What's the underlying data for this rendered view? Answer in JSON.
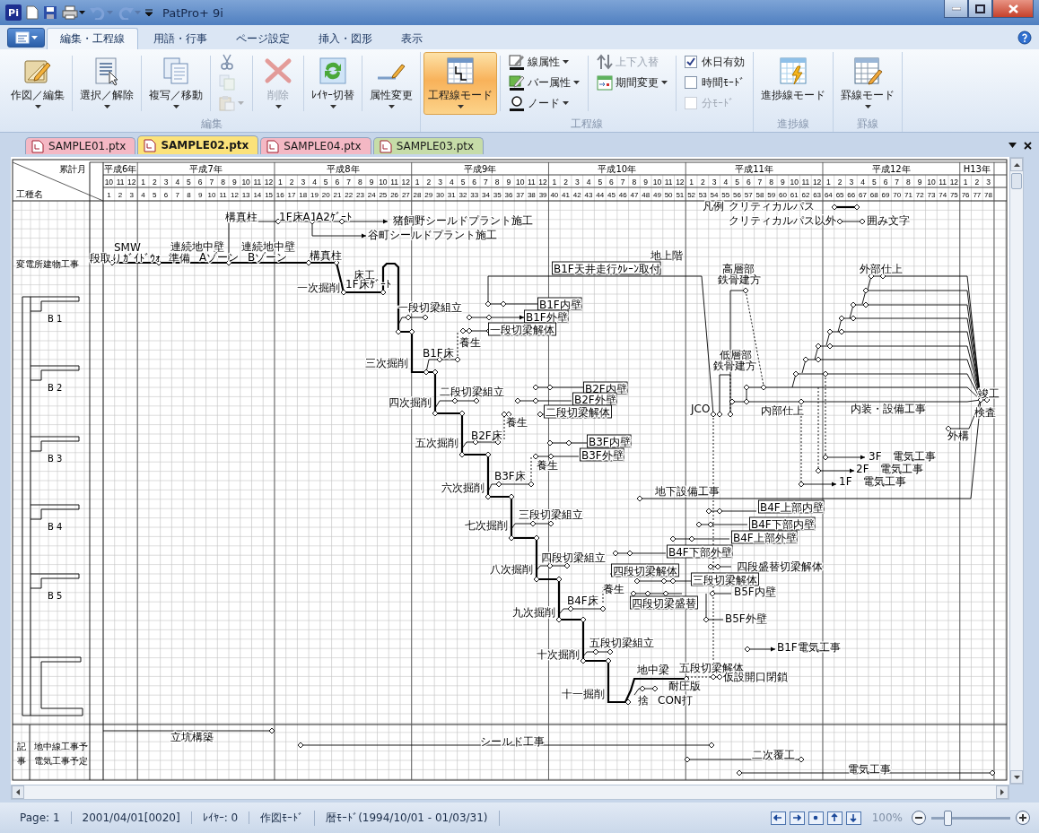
{
  "window": {
    "logo": "Pi",
    "title": "PatPro+ 9i"
  },
  "ribbon": {
    "tabs": [
      {
        "label": "編集・工程線",
        "selected": true
      },
      {
        "label": "用語・行事",
        "selected": false
      },
      {
        "label": "ページ設定",
        "selected": false
      },
      {
        "label": "挿入・図形",
        "selected": false
      },
      {
        "label": "表示",
        "selected": false
      }
    ],
    "groups": [
      {
        "label": "編集",
        "items": [
          {
            "kind": "large",
            "label": "作図／編集",
            "dropdown": true,
            "disabled": false,
            "on": false
          },
          {
            "kind": "large",
            "label": "選択／解除",
            "dropdown": true,
            "disabled": false,
            "on": false
          },
          {
            "kind": "large",
            "label": "複写／移動",
            "dropdown": true,
            "disabled": false,
            "on": false
          },
          {
            "kind": "stack",
            "items": [
              {
                "kind": "icon",
                "dropdown": false,
                "disabled": false
              },
              {
                "kind": "icon",
                "dropdown": false,
                "disabled": true
              },
              {
                "kind": "icon",
                "dropdown": true,
                "disabled": true
              }
            ]
          },
          {
            "kind": "large",
            "label": "削除",
            "dropdown": true,
            "disabled": true,
            "on": false
          },
          {
            "kind": "large",
            "label": "ﾚｲﾔｰ切替",
            "dropdown": true,
            "disabled": false,
            "on": false
          },
          {
            "kind": "large",
            "label": "属性変更",
            "dropdown": true,
            "disabled": false,
            "on": false
          }
        ]
      },
      {
        "label": "工程線",
        "items": [
          {
            "kind": "large",
            "label": "工程線モード",
            "dropdown": true,
            "disabled": false,
            "on": true
          },
          {
            "kind": "stack",
            "items": [
              {
                "kind": "tool",
                "label": "線属性",
                "dropdown": true,
                "disabled": false
              },
              {
                "kind": "tool",
                "label": "バー属性",
                "dropdown": true,
                "disabled": false
              },
              {
                "kind": "tool",
                "label": "ノード",
                "dropdown": true,
                "disabled": false
              }
            ]
          },
          {
            "kind": "stack",
            "items": [
              {
                "kind": "tool",
                "label": "上下入替",
                "dropdown": false,
                "disabled": true
              },
              {
                "kind": "tool",
                "label": "期間変更",
                "dropdown": true,
                "disabled": false
              }
            ]
          },
          {
            "kind": "stack",
            "items": [
              {
                "kind": "check",
                "label": "休日有効",
                "checked": true,
                "disabled": false
              },
              {
                "kind": "check",
                "label": "時間ﾓｰﾄﾞ",
                "checked": false,
                "disabled": false
              },
              {
                "kind": "check",
                "label": "分ﾓｰﾄﾞ",
                "checked": false,
                "disabled": true
              }
            ]
          }
        ]
      },
      {
        "label": "進捗線",
        "items": [
          {
            "kind": "large",
            "label": "進捗線モード",
            "dropdown": false,
            "disabled": false,
            "on": false
          }
        ]
      },
      {
        "label": "罫線",
        "items": [
          {
            "kind": "large",
            "label": "罫線モード",
            "dropdown": true,
            "disabled": false,
            "on": false
          }
        ]
      }
    ]
  },
  "documents": [
    {
      "label": "SAMPLE01.ptx",
      "selected": false,
      "color": "#f4b8c4"
    },
    {
      "label": "SAMPLE02.ptx",
      "selected": true,
      "color": "#fbe27a"
    },
    {
      "label": "SAMPLE04.ptx",
      "selected": false,
      "color": "#f4b8c4"
    },
    {
      "label": "SAMPLE03.ptx",
      "selected": false,
      "color": "#c6dca8"
    }
  ],
  "timeline": {
    "corner_top": "累計月",
    "corner_bottom": "工種名",
    "years": [
      "平成6年",
      "平成7年",
      "平成8年",
      "平成9年",
      "平成10年",
      "平成11年",
      "平成12年",
      "H13年"
    ],
    "months": [
      "10",
      "11",
      "12",
      "1",
      "2",
      "3",
      "4",
      "5",
      "6",
      "7",
      "8",
      "9",
      "10",
      "11",
      "12",
      "1",
      "2",
      "3",
      "4",
      "5",
      "6",
      "7",
      "8",
      "9",
      "10",
      "11",
      "12",
      "1",
      "2",
      "3",
      "4",
      "5",
      "6",
      "7",
      "8",
      "9",
      "10",
      "11",
      "12",
      "1",
      "2",
      "3",
      "4",
      "5",
      "6",
      "7",
      "8",
      "9",
      "10",
      "11",
      "12",
      "1",
      "2",
      "3",
      "4",
      "5",
      "6",
      "7",
      "8",
      "9",
      "10",
      "11",
      "12",
      "1",
      "2",
      "3",
      "4",
      "5",
      "6",
      "7",
      "8",
      "9",
      "10",
      "11",
      "12",
      "1",
      "2",
      "3"
    ],
    "numbers": [
      "1",
      "2",
      "3",
      "4",
      "5",
      "6",
      "7",
      "8",
      "9",
      "10",
      "11",
      "12",
      "13",
      "14",
      "15",
      "16",
      "17",
      "18",
      "19",
      "20",
      "21",
      "22",
      "23",
      "24",
      "25",
      "26",
      "27",
      "28",
      "29",
      "30",
      "31",
      "32",
      "33",
      "34",
      "35",
      "36",
      "37",
      "38",
      "39",
      "40",
      "41",
      "42",
      "43",
      "44",
      "45",
      "46",
      "47",
      "48",
      "49",
      "50",
      "51",
      "52",
      "53",
      "54",
      "55",
      "56",
      "57",
      "58",
      "59",
      "60",
      "61",
      "62",
      "63",
      "64",
      "65",
      "66",
      "67",
      "68",
      "69",
      "70",
      "71",
      "72",
      "73",
      "74",
      "75",
      "76",
      "77",
      "78"
    ]
  },
  "work_rows": {
    "main": "変電所建物工事",
    "levels": [
      "B 1",
      "B 2",
      "B 3",
      "B 4",
      "B 5"
    ],
    "notes_title": "記事",
    "notes": [
      "地中線工事予",
      "電気工事予定"
    ]
  },
  "diagram": {
    "labels": [
      {
        "text": "凡例",
        "boxed": false
      },
      {
        "text": "クリティカルパス",
        "boxed": false
      },
      {
        "text": "構真柱",
        "boxed": false
      },
      {
        "text": "1F床A1",
        "boxed": false
      },
      {
        "text": "A2ｹﾞｰﾄ",
        "boxed": false
      },
      {
        "text": "猪飼野シールドプラント施工",
        "boxed": false
      },
      {
        "text": "クリティカルパス以外",
        "boxed": false
      },
      {
        "text": "囲み文字",
        "boxed": false
      },
      {
        "text": "谷町シールドプラント施工",
        "boxed": false
      },
      {
        "text": "SMW",
        "boxed": false
      },
      {
        "text": "連続地中壁",
        "boxed": false
      },
      {
        "text": "連続地中壁",
        "boxed": false
      },
      {
        "text": "段取り",
        "boxed": false
      },
      {
        "text": "ｶﾞｲﾄﾞｳｫ",
        "boxed": false
      },
      {
        "text": "準備",
        "boxed": false
      },
      {
        "text": "Aゾーン",
        "boxed": false
      },
      {
        "text": "Bゾーン",
        "boxed": false
      },
      {
        "text": "構真柱",
        "boxed": false
      },
      {
        "text": "地上階",
        "boxed": false
      },
      {
        "text": "B1F天井走行ｸﾚｰﾝ取付",
        "boxed": true
      },
      {
        "text": "高層部",
        "boxed": false
      },
      {
        "text": "外部仕上",
        "boxed": false
      },
      {
        "text": "床工",
        "boxed": false
      },
      {
        "text": "鉄骨建方",
        "boxed": false
      },
      {
        "text": "一次掘削",
        "boxed": false
      },
      {
        "text": "1F床ｹﾞｰﾄ",
        "boxed": false
      },
      {
        "text": "一段切梁組立",
        "boxed": false
      },
      {
        "text": "B1F内壁",
        "boxed": true
      },
      {
        "text": "B1F外壁",
        "boxed": true
      },
      {
        "text": "一段切梁解体",
        "boxed": true
      },
      {
        "text": "養生",
        "boxed": false
      },
      {
        "text": "B1F床",
        "boxed": false
      },
      {
        "text": "低層部",
        "boxed": false
      },
      {
        "text": "三次掘削",
        "boxed": false
      },
      {
        "text": "鉄骨建方",
        "boxed": false
      },
      {
        "text": "二段切梁組立",
        "boxed": false
      },
      {
        "text": "B2F内壁",
        "boxed": true
      },
      {
        "text": "竣工",
        "boxed": false
      },
      {
        "text": "四次掘削",
        "boxed": false
      },
      {
        "text": "B2F外壁",
        "boxed": true
      },
      {
        "text": "二段切梁解体",
        "boxed": true
      },
      {
        "text": "JCO",
        "boxed": false
      },
      {
        "text": "内部仕上",
        "boxed": false
      },
      {
        "text": "内装・設備工事",
        "boxed": false
      },
      {
        "text": "検査",
        "boxed": false
      },
      {
        "text": "養生",
        "boxed": false
      },
      {
        "text": "B2F床",
        "boxed": false
      },
      {
        "text": "外構",
        "boxed": false
      },
      {
        "text": "五次掘削",
        "boxed": false
      },
      {
        "text": "B3F内壁",
        "boxed": true
      },
      {
        "text": "B3F外壁",
        "boxed": true
      },
      {
        "text": "3F　電気工事",
        "boxed": false
      },
      {
        "text": "養生",
        "boxed": false
      },
      {
        "text": "2F　電気工事",
        "boxed": false
      },
      {
        "text": "B3F床",
        "boxed": false
      },
      {
        "text": "1F　電気工事",
        "boxed": false
      },
      {
        "text": "六次掘削",
        "boxed": false
      },
      {
        "text": "地下設備工事",
        "boxed": false
      },
      {
        "text": "B4F上部内壁",
        "boxed": true
      },
      {
        "text": "三段切梁組立",
        "boxed": false
      },
      {
        "text": "七次掘削",
        "boxed": false
      },
      {
        "text": "B4F下部内壁",
        "boxed": true
      },
      {
        "text": "B4F上部外壁",
        "boxed": true
      },
      {
        "text": "B4F下部外壁",
        "boxed": true
      },
      {
        "text": "四段切梁組立",
        "boxed": false
      },
      {
        "text": "八次掘削",
        "boxed": false
      },
      {
        "text": "四段切梁解体",
        "boxed": true
      },
      {
        "text": "四段盛替切梁解体",
        "boxed": false
      },
      {
        "text": "三段切梁解体",
        "boxed": true
      },
      {
        "text": "養生",
        "boxed": false
      },
      {
        "text": "B5F内壁",
        "boxed": false
      },
      {
        "text": "B4F床",
        "boxed": false
      },
      {
        "text": "四段切梁盛替",
        "boxed": true
      },
      {
        "text": "九次掘削",
        "boxed": false
      },
      {
        "text": "B5F外壁",
        "boxed": false
      },
      {
        "text": "五段切梁組立",
        "boxed": false
      },
      {
        "text": "B1F電気工事",
        "boxed": false
      },
      {
        "text": "十次掘削",
        "boxed": false
      },
      {
        "text": "地中梁",
        "boxed": false
      },
      {
        "text": "五段切梁解体",
        "boxed": false
      },
      {
        "text": "仮設開口閉鎖",
        "boxed": false
      },
      {
        "text": "耐圧版",
        "boxed": false
      },
      {
        "text": "十一掘削",
        "boxed": false
      },
      {
        "text": "捨",
        "boxed": false
      },
      {
        "text": "CON打",
        "boxed": false
      },
      {
        "text": "立坑構築",
        "boxed": false
      },
      {
        "text": "シールド工事",
        "boxed": false
      },
      {
        "text": "二次覆工",
        "boxed": false
      },
      {
        "text": "電気工事",
        "boxed": false
      }
    ]
  },
  "status_bar": {
    "items": [
      "Page: 1",
      "2001/04/01[0020]",
      "ﾚｲﾔｰ: 0",
      "作図ﾓｰﾄﾞ",
      "暦ﾓｰﾄﾞ(1994/10/01 - 01/03/31)"
    ],
    "zoom": "100%",
    "zoom_level": {
      "level": 0.18
    }
  }
}
